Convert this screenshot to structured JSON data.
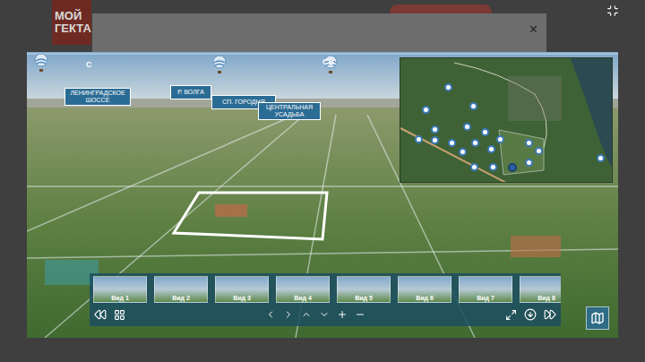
{
  "page": {
    "logo": {
      "line1": "МОЙ",
      "line2": "ГЕКТА"
    },
    "close": "×"
  },
  "viewer": {
    "compass": [
      {
        "label": "С"
      },
      {
        "label": "СВ"
      }
    ],
    "labels": [
      {
        "text": "ЛЕНИНГРАДСКОЕ ШОССЕ"
      },
      {
        "text": "Р. ВОЛГА"
      },
      {
        "text": "СП. ГОРОДНЯ"
      },
      {
        "text": "ЦЕНТРАЛЬНАЯ УСАДЬБА"
      }
    ],
    "minimap": {
      "pins": [
        {
          "selected": false
        },
        {
          "selected": false
        },
        {
          "selected": false
        },
        {
          "selected": false
        },
        {
          "selected": false
        },
        {
          "selected": false
        },
        {
          "selected": false
        },
        {
          "selected": false
        },
        {
          "selected": false
        },
        {
          "selected": false
        },
        {
          "selected": false
        },
        {
          "selected": false
        },
        {
          "selected": false
        },
        {
          "selected": false
        },
        {
          "selected": true
        },
        {
          "selected": false
        },
        {
          "selected": false
        },
        {
          "selected": false
        },
        {
          "selected": false
        },
        {
          "selected": false
        }
      ]
    },
    "views": [
      {
        "label": "Вид 1"
      },
      {
        "label": "Вид 2"
      },
      {
        "label": "Вид 3"
      },
      {
        "label": "Вид 4"
      },
      {
        "label": "Вид 5"
      },
      {
        "label": "Вид 6"
      },
      {
        "label": "Вид 7"
      },
      {
        "label": "Вид 8"
      }
    ]
  }
}
